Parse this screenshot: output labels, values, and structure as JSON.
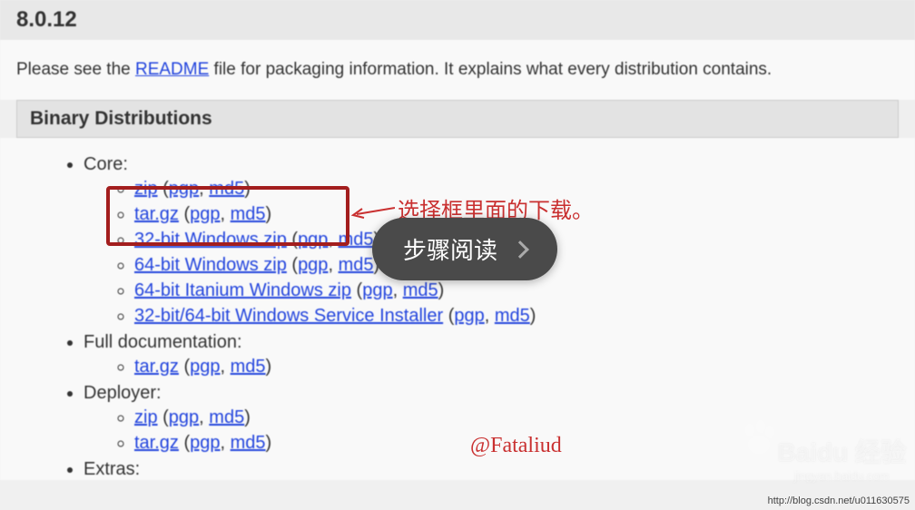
{
  "version": "8.0.12",
  "description_prefix": "Please see the ",
  "readme_link": "README",
  "description_suffix": " file for packaging information. It explains what every distribution contains.",
  "section_title": "Binary Distributions",
  "groups": [
    {
      "label": "Core:",
      "items": [
        {
          "text": "zip",
          "pgp": "pgp",
          "md5": "md5"
        },
        {
          "text": "tar.gz",
          "pgp": "pgp",
          "md5": "md5"
        },
        {
          "text": "32-bit Windows zip",
          "pgp": "pgp",
          "md5": "md5"
        },
        {
          "text": "64-bit Windows zip",
          "pgp": "pgp",
          "md5": "md5"
        },
        {
          "text": "64-bit Itanium Windows zip",
          "pgp": "pgp",
          "md5": "md5"
        },
        {
          "text": "32-bit/64-bit Windows Service Installer",
          "pgp": "pgp",
          "md5": "md5"
        }
      ]
    },
    {
      "label": "Full documentation:",
      "items": [
        {
          "text": "tar.gz",
          "pgp": "pgp",
          "md5": "md5"
        }
      ]
    },
    {
      "label": "Deployer:",
      "items": [
        {
          "text": "zip",
          "pgp": "pgp",
          "md5": "md5"
        },
        {
          "text": "tar.gz",
          "pgp": "pgp",
          "md5": "md5"
        }
      ]
    },
    {
      "label": "Extras:",
      "items": []
    }
  ],
  "annotation_text": "选择框里面的下载。",
  "step_button_label": "步骤阅读",
  "fataliud_text": "@Fataliud",
  "watermark_brand": "Baidu 经验",
  "watermark_sub": "jingyan.baidu.com",
  "source_url": "http://blog.csdn.net/u011630575"
}
